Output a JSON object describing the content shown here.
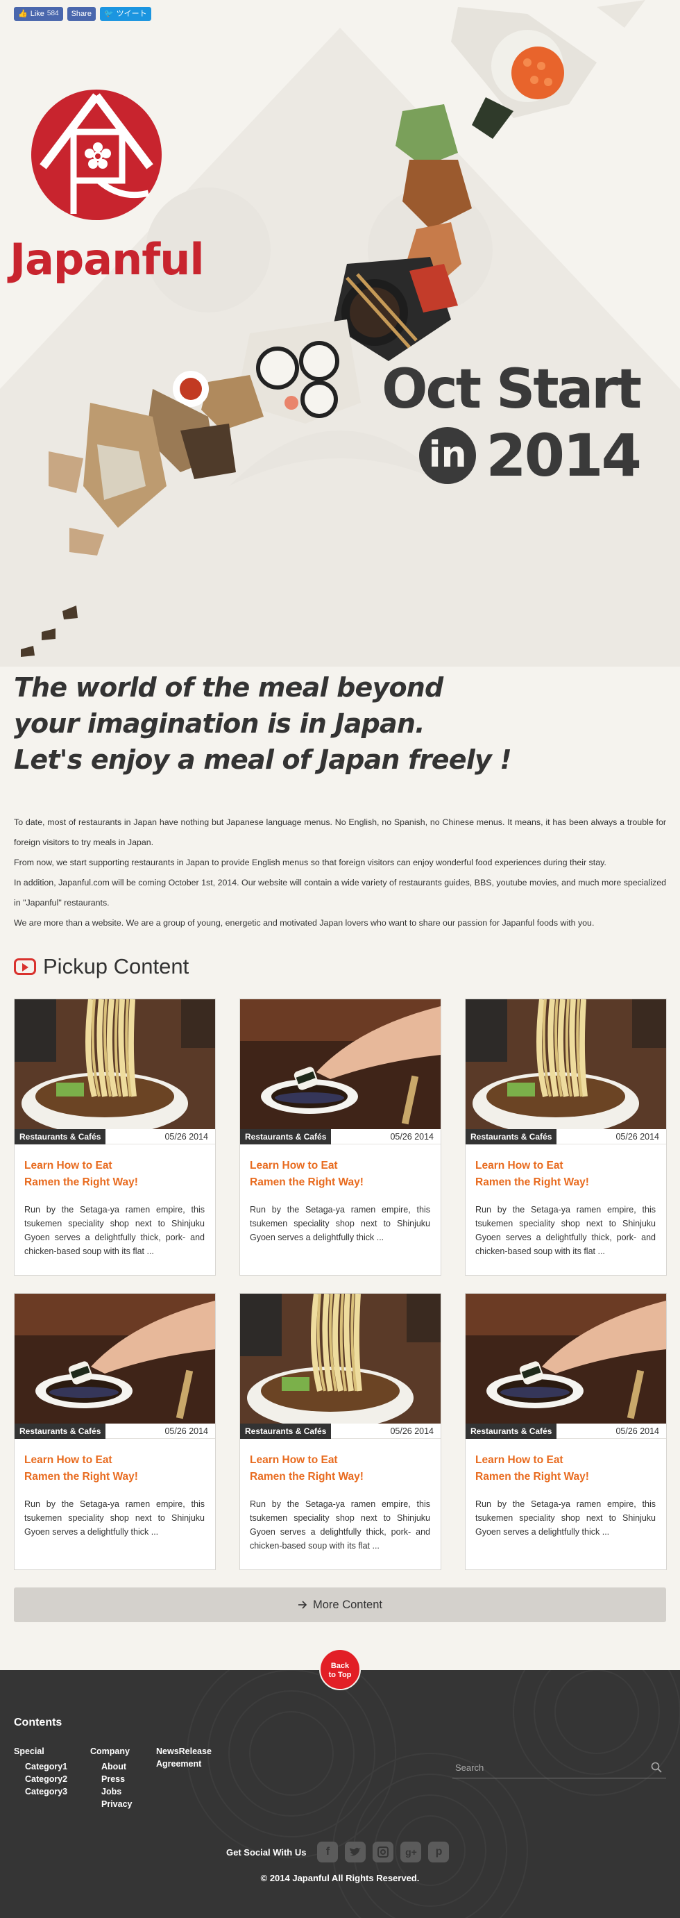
{
  "social_bar": {
    "like_label": "Like",
    "like_count": "584",
    "share_label": "Share",
    "tweet_label": "ツイート"
  },
  "brand": {
    "name": "Japanful",
    "logo_color": "#c8242e"
  },
  "launch": {
    "line1": "Oct Start",
    "in_word": "in",
    "year": "2014"
  },
  "tagline": {
    "line1": "The world of the meal beyond",
    "line2": "your imagination is in Japan.",
    "line3": "Let's enjoy a meal of Japan freely !"
  },
  "intro": {
    "p1": "To date, most of restaurants in Japan have nothing but Japanese language menus. No English, no Spanish, no Chinese menus. It means, it has been always a trouble for foreign visitors to try meals in Japan.",
    "p2": "From now, we start supporting restaurants in Japan to provide English menus so that foreign visitors can enjoy wonderful food experiences during their stay.",
    "p3": "In addition, Japanful.com will be coming October 1st, 2014. Our website will contain a wide variety of restaurants guides, BBS, youtube movies, and much more specialized in \"Japanful\" restaurants.",
    "p4": "We are more than a website. We are a group of young, energetic and motivated Japan lovers who want to share our passion for Japanful foods with you."
  },
  "pickup": {
    "title": "Pickup Content",
    "cards": [
      {
        "image": "ramen-noodles",
        "category": "Restaurants & Cafés",
        "date": "05/26 2014",
        "title_line1": "Learn How to Eat",
        "title_line2": "Ramen the Right Way!",
        "text": "Run by the Setaga-ya ramen empire, this tsukemen speciality shop next to Shinjuku Gyoen serves a delightfully thick, pork- and chicken-based soup with its flat ..."
      },
      {
        "image": "sushi-dip",
        "category": "Restaurants & Cafés",
        "date": "05/26 2014",
        "title_line1": "Learn How to Eat",
        "title_line2": "Ramen the Right Way!",
        "text": "Run by the Setaga-ya ramen empire, this tsukemen speciality shop next to Shinjuku Gyoen serves a delightfully thick ..."
      },
      {
        "image": "ramen-noodles",
        "category": "Restaurants & Cafés",
        "date": "05/26 2014",
        "title_line1": "Learn How to Eat",
        "title_line2": "Ramen the Right Way!",
        "text": "Run by the Setaga-ya ramen empire, this tsukemen speciality shop next to Shinjuku Gyoen serves a delightfully thick, pork- and chicken-based soup with its flat ..."
      },
      {
        "image": "sushi-dip",
        "category": "Restaurants & Cafés",
        "date": "05/26 2014",
        "title_line1": "Learn How to Eat",
        "title_line2": "Ramen the Right Way!",
        "text": "Run by the Setaga-ya ramen empire, this tsukemen speciality shop next to Shinjuku Gyoen serves a delightfully thick ..."
      },
      {
        "image": "ramen-noodles",
        "category": "Restaurants & Cafés",
        "date": "05/26 2014",
        "title_line1": "Learn How to Eat",
        "title_line2": "Ramen the Right Way!",
        "text": "Run by the Setaga-ya ramen empire, this tsukemen speciality shop next to Shinjuku Gyoen serves a delightfully thick, pork- and chicken-based soup with its flat ..."
      },
      {
        "image": "sushi-dip",
        "category": "Restaurants & Cafés",
        "date": "05/26 2014",
        "title_line1": "Learn How to Eat",
        "title_line2": "Ramen the Right Way!",
        "text": "Run by the Setaga-ya ramen empire, this tsukemen speciality shop next to Shinjuku Gyoen serves a delightfully thick ..."
      }
    ],
    "more_label": "More Content"
  },
  "back_to_top": {
    "line1": "Back",
    "line2": "to Top"
  },
  "footer": {
    "contents_title": "Contents",
    "col_special": {
      "title": "Special",
      "items": [
        "Category1",
        "Category2",
        "Category3"
      ]
    },
    "col_company": {
      "title": "Company",
      "items": [
        "About",
        "Press",
        "Jobs",
        "Privacy"
      ]
    },
    "col_news": {
      "title": "NewsRelease",
      "items": [
        "Agreement"
      ]
    },
    "search_placeholder": "Search",
    "social_label": "Get Social With Us",
    "social_icons": [
      "facebook-icon",
      "twitter-icon",
      "instagram-icon",
      "google-plus-icon",
      "pinterest-icon"
    ],
    "copyright": "© 2014 Japanful All Rights Reserved."
  }
}
